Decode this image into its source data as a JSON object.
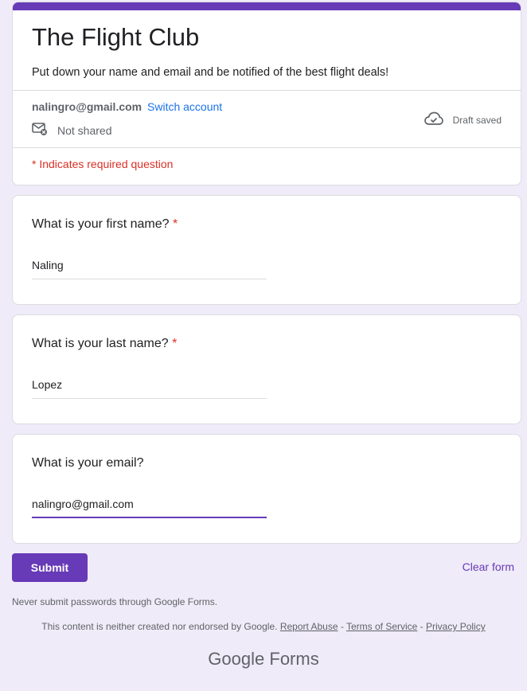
{
  "form": {
    "title": "The Flight Club",
    "description": "Put down your name and email and be notified of the best flight deals!",
    "account_email": "nalingro@gmail.com",
    "switch_account": "Switch account",
    "not_shared": "Not shared",
    "draft_status": "Draft saved",
    "required_note": "* Indicates required question",
    "accent_color": "#673ab7"
  },
  "questions": [
    {
      "title": "What is your first name?",
      "required_mark": "*",
      "value": "Naling"
    },
    {
      "title": "What is your last name?",
      "required_mark": "*",
      "value": "Lopez"
    },
    {
      "title": "What is your email?",
      "required_mark": "",
      "value": "nalingro@gmail.com"
    }
  ],
  "actions": {
    "submit": "Submit",
    "clear": "Clear form"
  },
  "footer": {
    "warning": "Never submit passwords through Google Forms.",
    "disclaimer": "This content is neither created nor endorsed by Google.",
    "report_abuse": "Report Abuse",
    "terms": "Terms of Service",
    "privacy": "Privacy Policy",
    "separator": " - ",
    "brand_google": "Google",
    "brand_forms": "Forms"
  }
}
